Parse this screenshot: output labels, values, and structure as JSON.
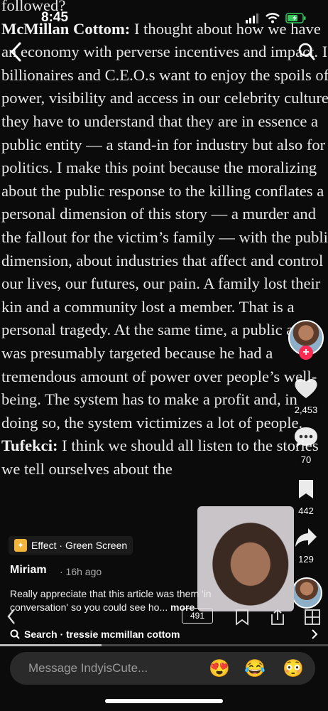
{
  "status": {
    "time": "8:45"
  },
  "article": {
    "fragment_top": "followed?",
    "p1_speaker": "McMillan Cottom:",
    "p1_text": " I thought about how we have an economy with perverse incentives and impact. If billionaires and C.E.O.s want to enjoy the spoils of power, visibility and access in our celebrity culture, they have to understand that they are in essence a public entity — a stand-in for industry but also for politics. I make this point because the moralizing about the public response to the killing conflates a personal dimension of this story — a murder and the fallout for the victim’s family — with the public dimension, about industries that affect and control our lives, our futures, our pain. A family lost their kin and a community lost a member. That is a personal tragedy. At the same time, a public actor was presumably targeted because he had a tremendous amount of power over people’s well-being. The system has to make a profit and, in doing so, the system victimizes a lot of people.",
    "p2_speaker": "Tufekci:",
    "p2_text": " I think we should all listen to the stories we tell ourselves about the"
  },
  "rail": {
    "likes": "2,453",
    "comments": "70",
    "saves": "442",
    "shares": "129"
  },
  "effect": {
    "label": "Effect · Green Screen"
  },
  "comment": {
    "user": "Miriam",
    "time": "· 16h ago",
    "text": "Really appreciate that this article was them 'in conversation' so you could see ho...",
    "more": "more",
    "replies": "491"
  },
  "search": {
    "text": "Search · tressie mcmillan cottom"
  },
  "progress_fraction": 0.31,
  "message": {
    "placeholder": "Message IndyisCute...",
    "emojis": [
      "😍",
      "😂",
      "😳"
    ]
  },
  "colors": {
    "accent": "#fe2c55",
    "battery": "#34c759"
  }
}
